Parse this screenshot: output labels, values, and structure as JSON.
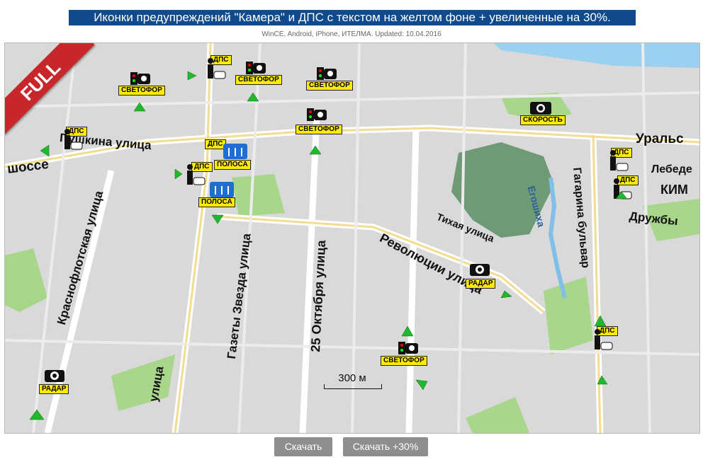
{
  "header": {
    "title": "Иконки предупреждений \"Камера\" и ДПС с текстом на желтом фоне + увеличенные на 30%.",
    "subtitle": "WinCE, Android, iPhone, ИТЕЛМА. Updated: 10.04.2016"
  },
  "map": {
    "badge": "FULL",
    "scale_label": "300 м",
    "streets": {
      "s1": "Пушкина улица",
      "s2": "шоссе",
      "s3": "Краснофлотская улица",
      "s4": "Газеты Звезда улица",
      "s5": "25 Октября улица",
      "s6": "Революции улица",
      "s7": "Тихая улица",
      "s8": "Гагарина бульвар",
      "s9": "Уральс",
      "s10": "Лебеде",
      "s11": "КИМ",
      "s12": "Дружбы",
      "s13": "Егошиха",
      "s14": "улица"
    },
    "markers": {
      "m1": "СВЕТОФОР",
      "m2": "ДПС",
      "m3": "СВЕТОФОР",
      "m4": "СВЕТОФОР",
      "m5": "СВЕТОФОР",
      "m6": "СКОРОСТЬ",
      "m7": "ДПС",
      "m8": "ДПС",
      "m9": "ПОЛОСА",
      "m10": "ДПС",
      "m11": "ПОЛОСА",
      "m12": "ДПС",
      "m13": "ДПС",
      "m14": "РАДАР",
      "m15": "СВЕТОФОР",
      "m16": "ДПС",
      "m17": "РАДАР"
    }
  },
  "buttons": {
    "download": "Скачать",
    "download_plus": "Скачать +30%"
  },
  "colors": {
    "header_bg": "#0f4a8c",
    "label_bg": "#ffeb00",
    "badge": "#c9262a",
    "park": "#a8d68a",
    "water": "#9bd0f0",
    "building": "#6f9a76",
    "arrow": "#22b82d"
  }
}
